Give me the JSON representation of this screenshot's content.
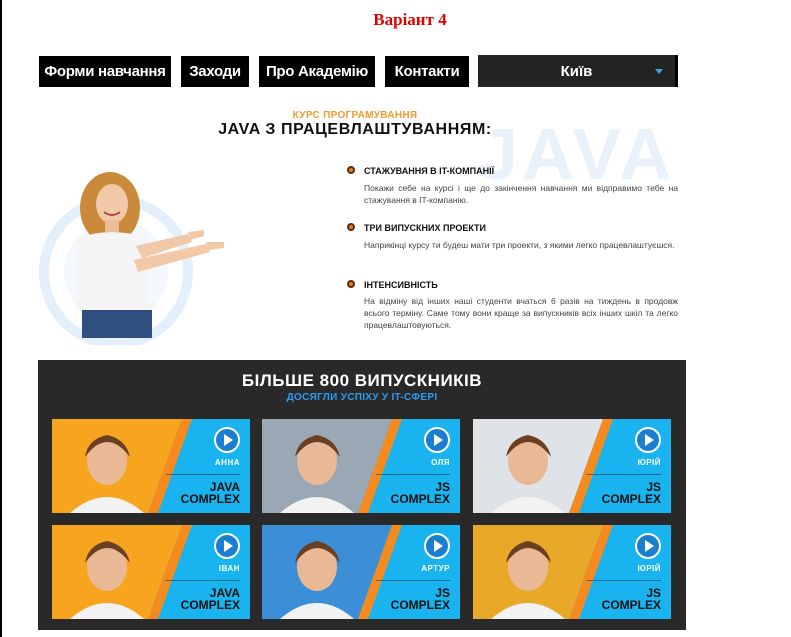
{
  "page": {
    "variant_title": "Варіант 4"
  },
  "nav": {
    "items": [
      "Форми навчання",
      "Заходи",
      "Про Академію",
      "Контакти"
    ],
    "city": "Київ"
  },
  "course": {
    "subtitle": "КУРС ПРОГРАМУВАННЯ",
    "title": "JAVA З ПРАЦЕВЛАШТУВАННЯМ:",
    "watermark": "JAVA",
    "features": [
      {
        "title": "СТАЖУВАННЯ В IT-КОМПАНІЇ",
        "text": "Покажи себе на курсі і ще до закінчення навчання ми відправимо тебе на стажування в IT-компанію."
      },
      {
        "title": "ТРИ ВИПУСКНИХ ПРОЕКТИ",
        "text": "Наприкінці курсу ти будеш мати три проекти, з якими легко працевлаштуєшся."
      },
      {
        "title": "ІНТЕНСИВНІСТЬ",
        "text": "На відміну від інших наші студенти вчаться 6 разів на тиждень в продовж всього терміну. Саме тому вони краще за випускників всіх інших шкіл та легко працевлаштовуються."
      }
    ]
  },
  "graduates": {
    "title": "БІЛЬШЕ 800 ВИПУСКНИКІВ",
    "subtitle": "ДОСЯГЛИ УСПІХУ У IT-СФЕРІ",
    "cards": [
      {
        "name": "АННА",
        "course1": "JAVA",
        "course2": "COMPLEX",
        "photo_bg": "#f7a51f"
      },
      {
        "name": "ОЛЯ",
        "course1": "JS",
        "course2": "COMPLEX",
        "photo_bg": "#9aa7b5"
      },
      {
        "name": "ЮРІЙ",
        "course1": "JS",
        "course2": "COMPLEX",
        "photo_bg": "#dfe3e8"
      },
      {
        "name": "ІВАН",
        "course1": "JAVA",
        "course2": "COMPLEX",
        "photo_bg": "#f7a51f"
      },
      {
        "name": "АРТУР",
        "course1": "JS",
        "course2": "COMPLEX",
        "photo_bg": "#3c8fd6"
      },
      {
        "name": "ЮРІЙ",
        "course1": "JS",
        "course2": "COMPLEX",
        "photo_bg": "#e8a928"
      }
    ]
  },
  "colors": {
    "accent_orange": "#f39a2c",
    "accent_blue": "#19b4f0",
    "dark_panel": "#292929",
    "variant_red": "#e00000"
  }
}
